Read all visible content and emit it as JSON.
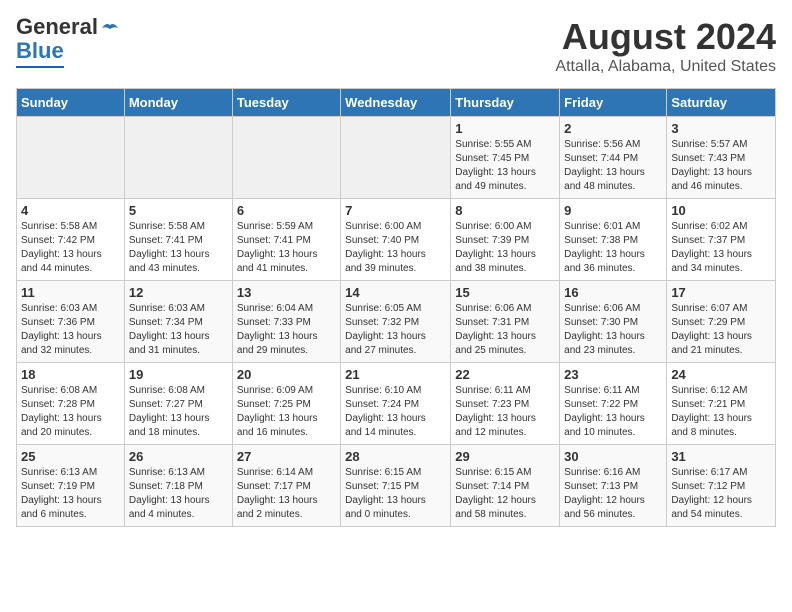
{
  "header": {
    "logo_line1": "General",
    "logo_line2": "Blue",
    "title": "August 2024",
    "subtitle": "Attalla, Alabama, United States"
  },
  "days_of_week": [
    "Sunday",
    "Monday",
    "Tuesday",
    "Wednesday",
    "Thursday",
    "Friday",
    "Saturday"
  ],
  "weeks": [
    [
      {
        "day": "",
        "info": ""
      },
      {
        "day": "",
        "info": ""
      },
      {
        "day": "",
        "info": ""
      },
      {
        "day": "",
        "info": ""
      },
      {
        "day": "1",
        "info": "Sunrise: 5:55 AM\nSunset: 7:45 PM\nDaylight: 13 hours\nand 49 minutes."
      },
      {
        "day": "2",
        "info": "Sunrise: 5:56 AM\nSunset: 7:44 PM\nDaylight: 13 hours\nand 48 minutes."
      },
      {
        "day": "3",
        "info": "Sunrise: 5:57 AM\nSunset: 7:43 PM\nDaylight: 13 hours\nand 46 minutes."
      }
    ],
    [
      {
        "day": "4",
        "info": "Sunrise: 5:58 AM\nSunset: 7:42 PM\nDaylight: 13 hours\nand 44 minutes."
      },
      {
        "day": "5",
        "info": "Sunrise: 5:58 AM\nSunset: 7:41 PM\nDaylight: 13 hours\nand 43 minutes."
      },
      {
        "day": "6",
        "info": "Sunrise: 5:59 AM\nSunset: 7:41 PM\nDaylight: 13 hours\nand 41 minutes."
      },
      {
        "day": "7",
        "info": "Sunrise: 6:00 AM\nSunset: 7:40 PM\nDaylight: 13 hours\nand 39 minutes."
      },
      {
        "day": "8",
        "info": "Sunrise: 6:00 AM\nSunset: 7:39 PM\nDaylight: 13 hours\nand 38 minutes."
      },
      {
        "day": "9",
        "info": "Sunrise: 6:01 AM\nSunset: 7:38 PM\nDaylight: 13 hours\nand 36 minutes."
      },
      {
        "day": "10",
        "info": "Sunrise: 6:02 AM\nSunset: 7:37 PM\nDaylight: 13 hours\nand 34 minutes."
      }
    ],
    [
      {
        "day": "11",
        "info": "Sunrise: 6:03 AM\nSunset: 7:36 PM\nDaylight: 13 hours\nand 32 minutes."
      },
      {
        "day": "12",
        "info": "Sunrise: 6:03 AM\nSunset: 7:34 PM\nDaylight: 13 hours\nand 31 minutes."
      },
      {
        "day": "13",
        "info": "Sunrise: 6:04 AM\nSunset: 7:33 PM\nDaylight: 13 hours\nand 29 minutes."
      },
      {
        "day": "14",
        "info": "Sunrise: 6:05 AM\nSunset: 7:32 PM\nDaylight: 13 hours\nand 27 minutes."
      },
      {
        "day": "15",
        "info": "Sunrise: 6:06 AM\nSunset: 7:31 PM\nDaylight: 13 hours\nand 25 minutes."
      },
      {
        "day": "16",
        "info": "Sunrise: 6:06 AM\nSunset: 7:30 PM\nDaylight: 13 hours\nand 23 minutes."
      },
      {
        "day": "17",
        "info": "Sunrise: 6:07 AM\nSunset: 7:29 PM\nDaylight: 13 hours\nand 21 minutes."
      }
    ],
    [
      {
        "day": "18",
        "info": "Sunrise: 6:08 AM\nSunset: 7:28 PM\nDaylight: 13 hours\nand 20 minutes."
      },
      {
        "day": "19",
        "info": "Sunrise: 6:08 AM\nSunset: 7:27 PM\nDaylight: 13 hours\nand 18 minutes."
      },
      {
        "day": "20",
        "info": "Sunrise: 6:09 AM\nSunset: 7:25 PM\nDaylight: 13 hours\nand 16 minutes."
      },
      {
        "day": "21",
        "info": "Sunrise: 6:10 AM\nSunset: 7:24 PM\nDaylight: 13 hours\nand 14 minutes."
      },
      {
        "day": "22",
        "info": "Sunrise: 6:11 AM\nSunset: 7:23 PM\nDaylight: 13 hours\nand 12 minutes."
      },
      {
        "day": "23",
        "info": "Sunrise: 6:11 AM\nSunset: 7:22 PM\nDaylight: 13 hours\nand 10 minutes."
      },
      {
        "day": "24",
        "info": "Sunrise: 6:12 AM\nSunset: 7:21 PM\nDaylight: 13 hours\nand 8 minutes."
      }
    ],
    [
      {
        "day": "25",
        "info": "Sunrise: 6:13 AM\nSunset: 7:19 PM\nDaylight: 13 hours\nand 6 minutes."
      },
      {
        "day": "26",
        "info": "Sunrise: 6:13 AM\nSunset: 7:18 PM\nDaylight: 13 hours\nand 4 minutes."
      },
      {
        "day": "27",
        "info": "Sunrise: 6:14 AM\nSunset: 7:17 PM\nDaylight: 13 hours\nand 2 minutes."
      },
      {
        "day": "28",
        "info": "Sunrise: 6:15 AM\nSunset: 7:15 PM\nDaylight: 13 hours\nand 0 minutes."
      },
      {
        "day": "29",
        "info": "Sunrise: 6:15 AM\nSunset: 7:14 PM\nDaylight: 12 hours\nand 58 minutes."
      },
      {
        "day": "30",
        "info": "Sunrise: 6:16 AM\nSunset: 7:13 PM\nDaylight: 12 hours\nand 56 minutes."
      },
      {
        "day": "31",
        "info": "Sunrise: 6:17 AM\nSunset: 7:12 PM\nDaylight: 12 hours\nand 54 minutes."
      }
    ]
  ]
}
